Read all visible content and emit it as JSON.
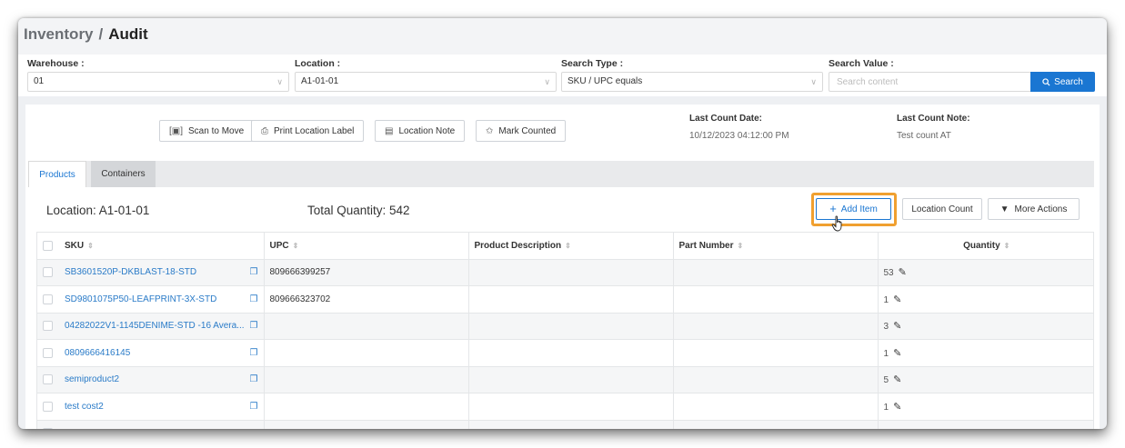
{
  "breadcrumb": {
    "parent": "Inventory",
    "separator": "/",
    "current": "Audit"
  },
  "filters": {
    "warehouse": {
      "label": "Warehouse :",
      "value": "01"
    },
    "location": {
      "label": "Location :",
      "value": "A1-01-01"
    },
    "search_type": {
      "label": "Search Type :",
      "value": "SKU / UPC equals"
    },
    "search_value": {
      "label": "Search Value :",
      "placeholder": "Search content",
      "button_label": "Search"
    }
  },
  "actions": {
    "scan_to_move": "Scan to Move",
    "print_location_label": "Print Location Label",
    "location_note": "Location Note",
    "mark_counted": "Mark Counted"
  },
  "last_count": {
    "date_label": "Last Count Date:",
    "date_value": "10/12/2023 04:12:00 PM",
    "note_label": "Last Count Note:",
    "note_value": "Test count AT"
  },
  "tabs": [
    {
      "label": "Products",
      "active": true
    },
    {
      "label": "Containers",
      "active": false
    }
  ],
  "summary": {
    "location": "Location: A1-01-01",
    "total_quantity": "Total Quantity: 542"
  },
  "toolbar": {
    "add_item": "Add Item",
    "location_count": "Location Count",
    "more_actions": "More Actions"
  },
  "table": {
    "headers": {
      "sku": "SKU",
      "upc": "UPC",
      "description": "Product Description",
      "part_number": "Part Number",
      "quantity": "Quantity"
    },
    "rows": [
      {
        "sku": "SB3601520P-DKBLAST-18-STD",
        "upc": "809666399257",
        "description": "",
        "part_number": "",
        "quantity": "53"
      },
      {
        "sku": "SD9801075P50-LEAFPRINT-3X-STD",
        "upc": "809666323702",
        "description": "",
        "part_number": "",
        "quantity": "1"
      },
      {
        "sku": "04282022V1-1145DENIME-STD -16 Avera...",
        "upc": "",
        "description": "",
        "part_number": "",
        "quantity": "3"
      },
      {
        "sku": "0809666416145",
        "upc": "",
        "description": "",
        "part_number": "",
        "quantity": "1"
      },
      {
        "sku": "semiproduct2",
        "upc": "",
        "description": "",
        "part_number": "",
        "quantity": "5"
      },
      {
        "sku": "test cost2",
        "upc": "",
        "description": "",
        "part_number": "",
        "quantity": "1"
      },
      {
        "sku": "",
        "upc": "",
        "description": "",
        "part_number": "",
        "quantity": ""
      }
    ]
  },
  "colors": {
    "accent": "#1a76d2",
    "link": "#2a7bc8",
    "highlight": "#f0a030"
  }
}
